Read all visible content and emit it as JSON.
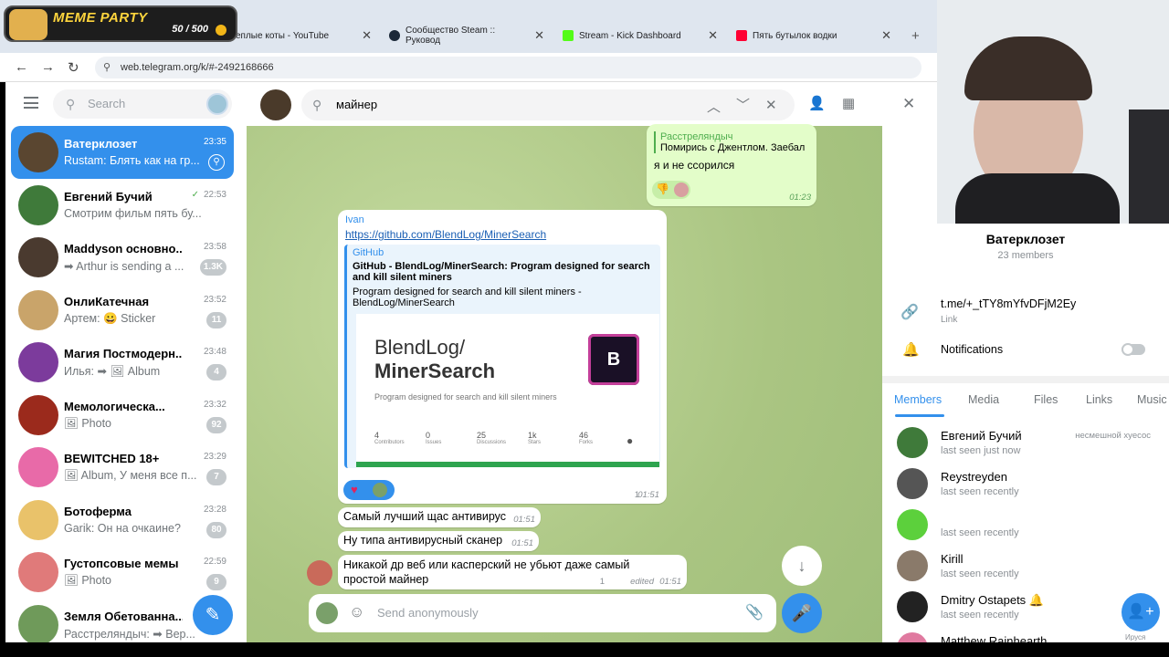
{
  "browser": {
    "tabs": [
      {
        "title": "еплые коты - YouTube"
      },
      {
        "title": "Сообщество Steam :: Руковод"
      },
      {
        "title": "Stream - Kick Dashboard"
      },
      {
        "title": "Пять бутылок водки"
      }
    ],
    "url": "web.telegram.org/k/#-2492168666"
  },
  "overlay": {
    "title": "MEME PARTY",
    "counter": "50 / 500"
  },
  "sidebar": {
    "search_placeholder": "Search",
    "chats": [
      {
        "name": "Ватерклозет",
        "time": "23:35",
        "preview": "Rustam: Блять как на гр...",
        "active": true,
        "avatar_color": "#5a4630"
      },
      {
        "name": "Евгений Бучий",
        "time": "22:53",
        "preview": "Смотрим фильм пять бу...",
        "check": "✓",
        "avatar_color": "#3f7a3a"
      },
      {
        "name": "Maddyson основно...",
        "time": "23:58",
        "preview": "➡ Arthur is sending a ...",
        "badge": "1.3K",
        "avatar_color": "#4a3a2f"
      },
      {
        "name": "ОнлиКатечная",
        "time": "23:52",
        "preview": "Артем: 😀 Sticker",
        "badge": "11",
        "avatar_color": "#c9a46a"
      },
      {
        "name": "Магия Постмодерн...",
        "time": "23:48",
        "preview": "Илья: ➡ 🖼 Album",
        "badge": "4",
        "avatar_color": "#7c3b9c"
      },
      {
        "name": "Мемологическа...",
        "time": "23:32",
        "preview": "🖼 Photo",
        "badge": "92",
        "avatar_color": "#9b2a1c"
      },
      {
        "name": "BEWITCHED 18+",
        "time": "23:29",
        "preview": "🖼 Album, У меня все п...",
        "badge": "7",
        "avatar_color": "#e86aa8"
      },
      {
        "name": "Ботоферма",
        "time": "23:28",
        "preview": "Garik: Он на очкаине?",
        "badge": "80",
        "avatar_color": "#e9c26a"
      },
      {
        "name": "Густопсовые мемы",
        "time": "22:59",
        "preview": "🖼 Photo",
        "badge": "9",
        "avatar_color": "#e07a7a"
      },
      {
        "name": "Земля Обетованна...",
        "time": "",
        "preview": "Расстреляндыч: ➡ Вер...",
        "badge": "",
        "avatar_color": "#6f9a5a"
      }
    ]
  },
  "chat": {
    "search_query": "майнер",
    "messages": {
      "top_quote_name": "Расстреляндыч",
      "top_quote_text": "Помирись с Джентлом. Заебал",
      "top_text": "я и не ссорился",
      "top_time": "01:23",
      "link_sender": "Ivan",
      "link_url": "https://github.com/BlendLog/MinerSearch",
      "preview_site": "GitHub",
      "preview_title": "GitHub - BlendLog/MinerSearch: Program designed for search and kill silent miners",
      "preview_desc": "Program designed for search and kill silent miners - BlendLog/MinerSearch",
      "img_owner": "BlendLog/",
      "img_repo": "MinerSearch",
      "img_desc": "Program designed for search and kill silent miners",
      "stats": [
        {
          "value": "4",
          "label": "Contributors"
        },
        {
          "value": "0",
          "label": "Issues"
        },
        {
          "value": "25",
          "label": "Discussions"
        },
        {
          "value": "1k",
          "label": "Stars"
        },
        {
          "value": "46",
          "label": "Forks"
        }
      ],
      "link_time": "01:51",
      "link_replies": "1",
      "m1": "Самый лучший щас антивирус",
      "m1_time": "01:51",
      "m2": "Ну типа антивирусный сканер",
      "m2_time": "01:51",
      "m3": "Никакой др веб или касперский не убьют даже самый простой майнер",
      "m3_time": "01:51",
      "m3_edited": "edited",
      "m3_replies": "1"
    },
    "composer_placeholder": "Send anonymously"
  },
  "right": {
    "group_name": "Ватерклозет",
    "members_count": "23 members",
    "link_value": "t.me/+_tTY8mYfvDFjM2Ey",
    "link_label": "Link",
    "notifications": "Notifications",
    "tabs": [
      "Members",
      "Media",
      "Files",
      "Links",
      "Music"
    ],
    "members": [
      {
        "name": "Евгений Бучий",
        "status": "last seen just now",
        "rank": "несмешной хуесос",
        "color": "#3f7a3a"
      },
      {
        "name": "Reystreyden",
        "status": "last seen recently",
        "rank": "",
        "color": "#555"
      },
      {
        "name": "",
        "status": "last seen recently",
        "rank": "",
        "color": "#5cd03c"
      },
      {
        "name": "Kirill",
        "status": "last seen recently",
        "rank": "",
        "color": "#8a7a6a"
      },
      {
        "name": "Dmitry Ostapets 🔔",
        "status": "last seen recently",
        "rank": "",
        "color": "#222"
      },
      {
        "name": "Matthew Rainhearth",
        "status": "",
        "rank": "",
        "color": "#e07aa0"
      }
    ],
    "add_label": "Ируся"
  },
  "colors": {
    "accent": "#3390ec",
    "chat_bg": "#b7cf8f",
    "out_bubble": "#e3fdc9"
  }
}
